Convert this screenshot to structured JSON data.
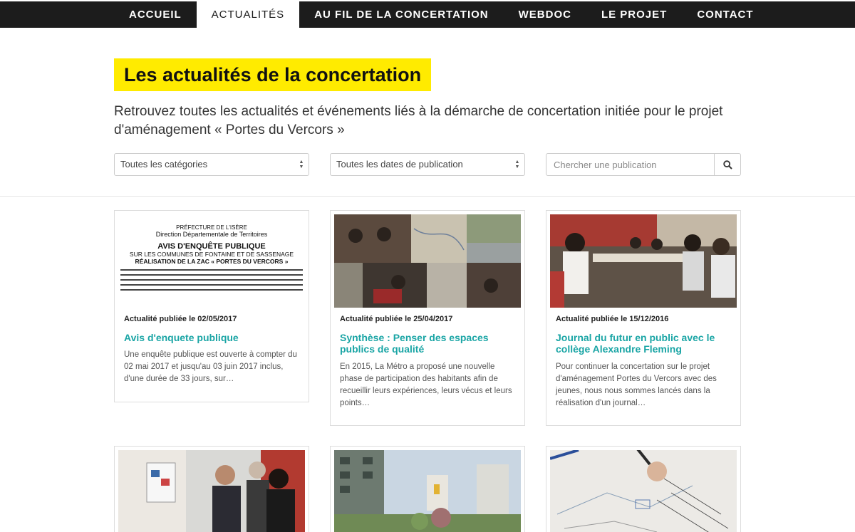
{
  "nav": {
    "items": [
      {
        "label": "ACCUEIL",
        "active": false
      },
      {
        "label": "ACTUALITÉS",
        "active": true
      },
      {
        "label": "AU FIL DE LA CONCERTATION",
        "active": false
      },
      {
        "label": "WEBDOC",
        "active": false
      },
      {
        "label": "LE PROJET",
        "active": false
      },
      {
        "label": "CONTACT",
        "active": false
      }
    ]
  },
  "header": {
    "title": "Les actualités de la concertation",
    "intro": "Retrouvez toutes les actualités et événements liés à la démarche de concertation initiée pour le projet d'aménagement « Portes du Vercors »"
  },
  "filters": {
    "category": "Toutes les catégories",
    "date": "Toutes les dates de publication",
    "search_placeholder": "Chercher une publication"
  },
  "notice_image": {
    "line1": "PRÉFECTURE DE L'ISÈRE",
    "line2": "Direction Départementale de Territoires",
    "line3": "AVIS D'ENQUÊTE PUBLIQUE",
    "line4": "SUR LES COMMUNES DE FONTAINE ET DE SASSENAGE",
    "line5": "RÉALISATION DE LA ZAC « PORTES DU VERCORS »"
  },
  "cards": [
    {
      "meta": "Actualité publiée le 02/05/2017",
      "title": "Avis d'enquete publique",
      "excerpt": "Une enquête publique est ouverte à compter du 02 mai 2017 et jusqu'au 03 juin 2017 inclus, d'une durée de 33 jours, sur…"
    },
    {
      "meta": "Actualité publiée le 25/04/2017",
      "title": "Synthèse : Penser des espaces publics de qualité",
      "excerpt": "En 2015, La Métro a proposé une nouvelle phase de participation des habitants afin de recueillir leurs expériences, leurs vécus et leurs points…"
    },
    {
      "meta": "Actualité publiée le 15/12/2016",
      "title": "Journal du futur en public avec le collège Alexandre Fleming",
      "excerpt": "Pour continuer la concertation sur le projet d'aménagement Portes du Vercors avec des jeunes, nous nous sommes lancés dans la réalisation d'un journal…"
    }
  ],
  "colors": {
    "nav_bg": "#1c1c1c",
    "title_bg": "#ffeb00",
    "link": "#1aa5a5"
  }
}
